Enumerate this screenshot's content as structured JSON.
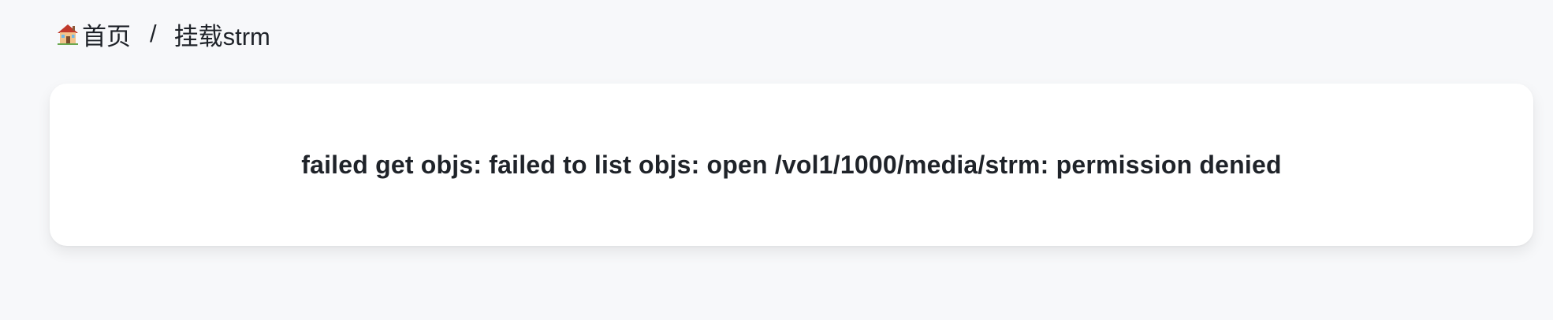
{
  "breadcrumb": {
    "home": {
      "label": "首页",
      "icon": "house-icon"
    },
    "separator": "/",
    "current": {
      "label": "挂载strm"
    }
  },
  "error": {
    "message": "failed get objs: failed to list objs: open /vol1/1000/media/strm: permission denied"
  },
  "colors": {
    "page_background": "#f7f8fa",
    "card_background": "#ffffff",
    "text": "#1f2329"
  }
}
